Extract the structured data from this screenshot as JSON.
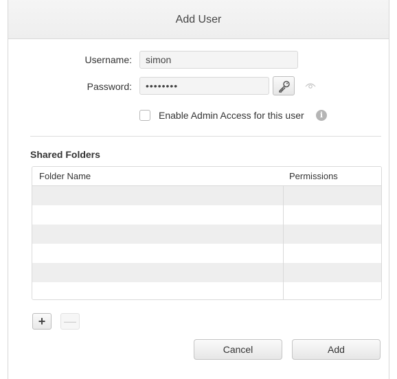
{
  "dialog": {
    "title": "Add User"
  },
  "form": {
    "username_label": "Username:",
    "username_value": "simon",
    "password_label": "Password:",
    "password_value": "••••••••",
    "admin_checkbox_label": "Enable Admin Access for this user",
    "admin_checked": false,
    "info_icon_text": "i"
  },
  "shared_folders": {
    "title": "Shared Folders",
    "columns": [
      "Folder Name",
      "Permissions"
    ],
    "rows": []
  },
  "buttons": {
    "add_folder": "+",
    "remove_folder": "—",
    "cancel": "Cancel",
    "add": "Add"
  },
  "icons": {
    "key": "key-icon",
    "reveal": "eye-icon",
    "info": "info-icon"
  }
}
